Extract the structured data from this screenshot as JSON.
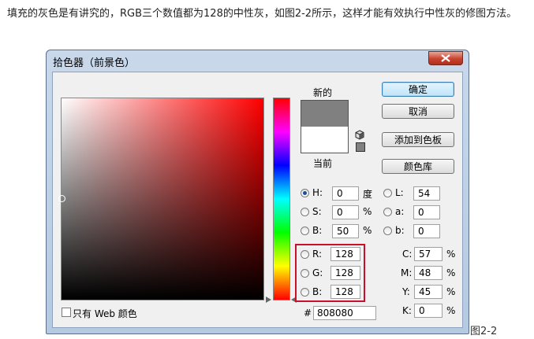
{
  "article": {
    "text": "填充的灰色是有讲究的，RGB三个数值都为128的中性灰，如图2-2所示，这样才能有效执行中性灰的修图方法。",
    "caption": "图2-2"
  },
  "dialog": {
    "title": "拾色器（前景色）",
    "label_new": "新的",
    "label_current": "当前",
    "new_color": "#808080",
    "current_color": "#ffffff",
    "buttons": {
      "ok": "确定",
      "cancel": "取消",
      "add_to_swatches": "添加到色板",
      "color_libraries": "颜色库"
    },
    "hsb": {
      "h_label": "H:",
      "h_value": "0",
      "h_unit": "度",
      "s_label": "S:",
      "s_value": "0",
      "s_unit": "%",
      "b_label": "B:",
      "b_value": "50",
      "b_unit": "%"
    },
    "lab": {
      "l_label": "L:",
      "l_value": "54",
      "a_label": "a:",
      "a_value": "0",
      "b_label": "b:",
      "b_value": "0"
    },
    "rgb": {
      "r_label": "R:",
      "r_value": "128",
      "g_label": "G:",
      "g_value": "128",
      "b_label": "B:",
      "b_value": "128"
    },
    "cmyk": {
      "c_label": "C:",
      "c_value": "57",
      "m_label": "M:",
      "m_value": "48",
      "y_label": "Y:",
      "y_value": "45",
      "k_label": "K:",
      "k_value": "0",
      "unit": "%"
    },
    "hex_label": "#",
    "hex_value": "808080",
    "web_only_label": "只有 Web 颜色",
    "selected_mode": "H",
    "hue_color": "#ff0000",
    "highlight_color": "#c8102e"
  }
}
